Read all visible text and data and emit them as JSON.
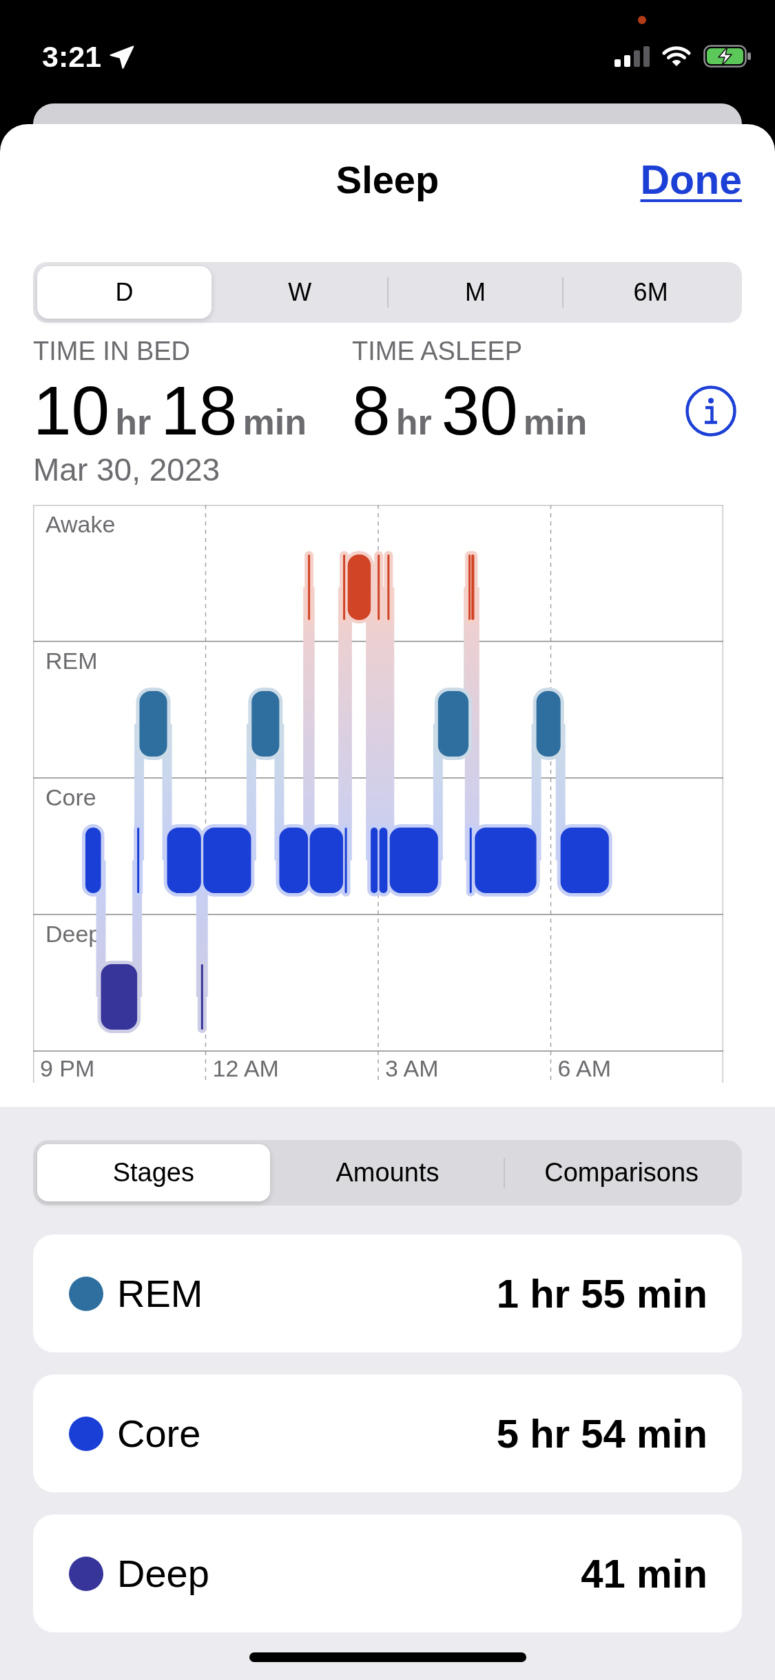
{
  "status_bar": {
    "time": "3:21",
    "battery": {
      "charging": true
    }
  },
  "header": {
    "title": "Sleep",
    "done_button": "Done"
  },
  "range_tabs": [
    {
      "label": "D",
      "selected": true
    },
    {
      "label": "W",
      "selected": false
    },
    {
      "label": "M",
      "selected": false
    },
    {
      "label": "6M",
      "selected": false
    }
  ],
  "summary": {
    "stats": [
      {
        "label": "TIME IN BED",
        "parts": [
          {
            "number": "10",
            "unit": "hr"
          },
          {
            "number": "18",
            "unit": "min"
          }
        ]
      },
      {
        "label": "TIME ASLEEP",
        "parts": [
          {
            "number": "8",
            "unit": "hr"
          },
          {
            "number": "30",
            "unit": "min"
          }
        ]
      }
    ],
    "date": "Mar 30, 2023"
  },
  "chart": {
    "stage_labels": [
      "Awake",
      "REM",
      "Core",
      "Deep"
    ],
    "time_labels": [
      "9 PM",
      "12 AM",
      "3 AM",
      "6 AM"
    ]
  },
  "view_tabs": [
    {
      "label": "Stages",
      "selected": true
    },
    {
      "label": "Amounts",
      "selected": false
    },
    {
      "label": "Comparisons",
      "selected": false
    }
  ],
  "stages": [
    {
      "name": "REM",
      "value": "1 hr 55 min",
      "color": "#2f6f9f"
    },
    {
      "name": "Core",
      "value": "5 hr 54 min",
      "color": "#1a3fd6"
    },
    {
      "name": "Deep",
      "value": "41 min",
      "color": "#37359a"
    }
  ]
}
